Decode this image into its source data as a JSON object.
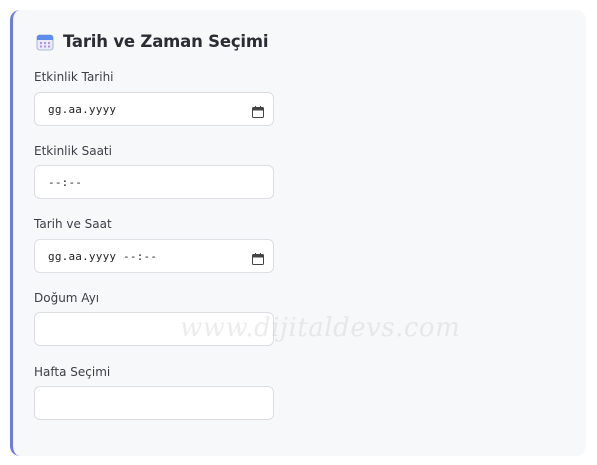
{
  "section": {
    "title": "Tarih ve Zaman Seçimi",
    "icon": "calendar-icon"
  },
  "fields": [
    {
      "label": "Etkinlik Tarihi",
      "value": "gg.aa.yyyy",
      "type": "date"
    },
    {
      "label": "Etkinlik Saati",
      "value": "--:--",
      "type": "time"
    },
    {
      "label": "Tarih ve Saat",
      "value": "gg.aa.yyyy --:--",
      "type": "datetime-local"
    },
    {
      "label": "Doğum Ayı",
      "value": "",
      "type": "month"
    },
    {
      "label": "Hafta Seçimi",
      "value": "",
      "type": "week"
    }
  ],
  "watermark": "www.dijitaldevs.com",
  "colors": {
    "accent_border": "#6c7be0",
    "card_background": "#f7f8fa",
    "input_border": "#dcdee4"
  }
}
